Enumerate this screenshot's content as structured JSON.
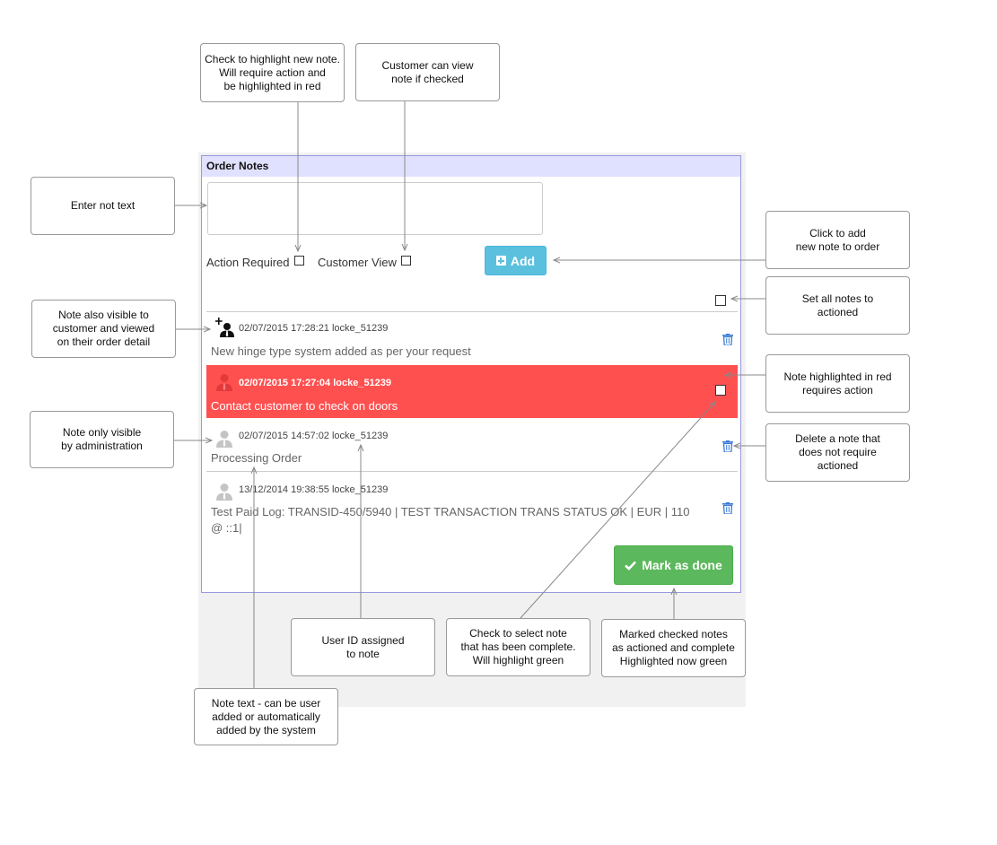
{
  "panel": {
    "title": "Order Notes",
    "textarea_value": "",
    "action_required_label": "Action Required",
    "customer_view_label": "Customer View",
    "add_label": "Add",
    "mark_done_label": "Mark as done"
  },
  "notes": [
    {
      "meta": "02/07/2015 17:28:21 locke_51239",
      "text": "New hinge type system added as per your request",
      "icon": "user-plus-icon",
      "highlight": "none"
    },
    {
      "meta": "02/07/2015 17:27:04 locke_51239",
      "text": "Contact customer to check on doors",
      "icon": "user-icon",
      "highlight": "red"
    },
    {
      "meta": "02/07/2015 14:57:02 locke_51239",
      "text": "Processing Order",
      "icon": "user-icon",
      "highlight": "none"
    },
    {
      "meta": "13/12/2014 19:38:55 locke_51239",
      "text": "Test Paid Log: TRANSID-450/5940 | TEST TRANSACTION TRANS STATUS OK | EUR | 110 @ ::1|",
      "icon": "user-icon",
      "highlight": "none"
    }
  ],
  "callouts": {
    "highlight_new": "Check to highlight new note.\nWill require action and\nbe highlighted in red",
    "customer_view": "Customer can view\nnote if checked",
    "enter_text": "Enter not text",
    "click_add": "Click to add\nnew note to order",
    "set_all": "Set all notes to\nactioned",
    "visible_customer": "Note also visible to\ncustomer and viewed\non their order detail",
    "highlighted_red": "Note highlighted in red\nrequires action",
    "admin_only": "Note only visible\nby administration",
    "delete_note": "Delete a note that\ndoes not require\nactioned",
    "user_id": "User ID assigned\nto note",
    "check_select": "Check to select note\nthat has been complete.\nWill highlight green",
    "marked_checked": "Marked checked notes\nas actioned and complete\nHighlighted now green",
    "note_text": "Note text - can be user\nadded or automatically\nadded by the system"
  },
  "colors": {
    "header_bg": "#e0e0ff",
    "add_button": "#5bc0de",
    "action_red": "#ff5050",
    "done_green": "#5cb85c",
    "trash_blue": "#3a7bd5"
  }
}
